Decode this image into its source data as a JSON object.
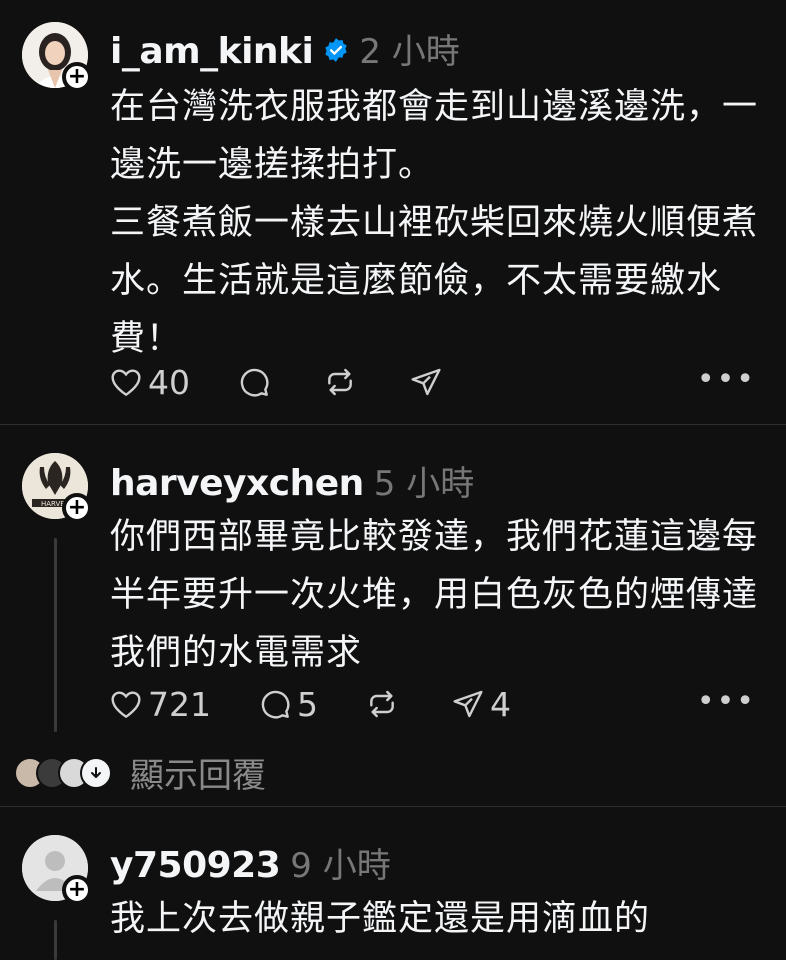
{
  "posts": [
    {
      "username": "i_am_kinki",
      "time": "2 小時",
      "verified": true,
      "lines": [
        "在台灣洗衣服我都會走到山邊溪邊洗，一邊洗一邊搓揉拍打。",
        "三餐煮飯一樣去山裡砍柴回來燒火順便煮水。生活就是這麼節儉，不太需要繳水費！"
      ],
      "likes": "40",
      "comments": "",
      "reposts": "",
      "shares": ""
    },
    {
      "username": "harveyxchen",
      "time": "5 小時",
      "verified": false,
      "lines": [
        "你們西部畢竟比較發達，我們花蓮這邊每半年要升一次火堆，用白色灰色的煙傳達我們的水電需求"
      ],
      "likes": "721",
      "comments": "5",
      "reposts": "",
      "shares": "4"
    },
    {
      "username": "y750923",
      "time": "9 小時",
      "verified": false,
      "lines": [
        "我上次去做親子鑑定還是用滴血的"
      ]
    }
  ],
  "show_replies_label": "顯示回覆",
  "colors": {
    "background": "#101010",
    "text": "#f3f5f7",
    "muted": "#777777",
    "verified": "#0095f6"
  },
  "icons": [
    "heart-icon",
    "comment-icon",
    "repost-icon",
    "share-icon",
    "more-icon",
    "plus-icon",
    "verified-icon"
  ]
}
